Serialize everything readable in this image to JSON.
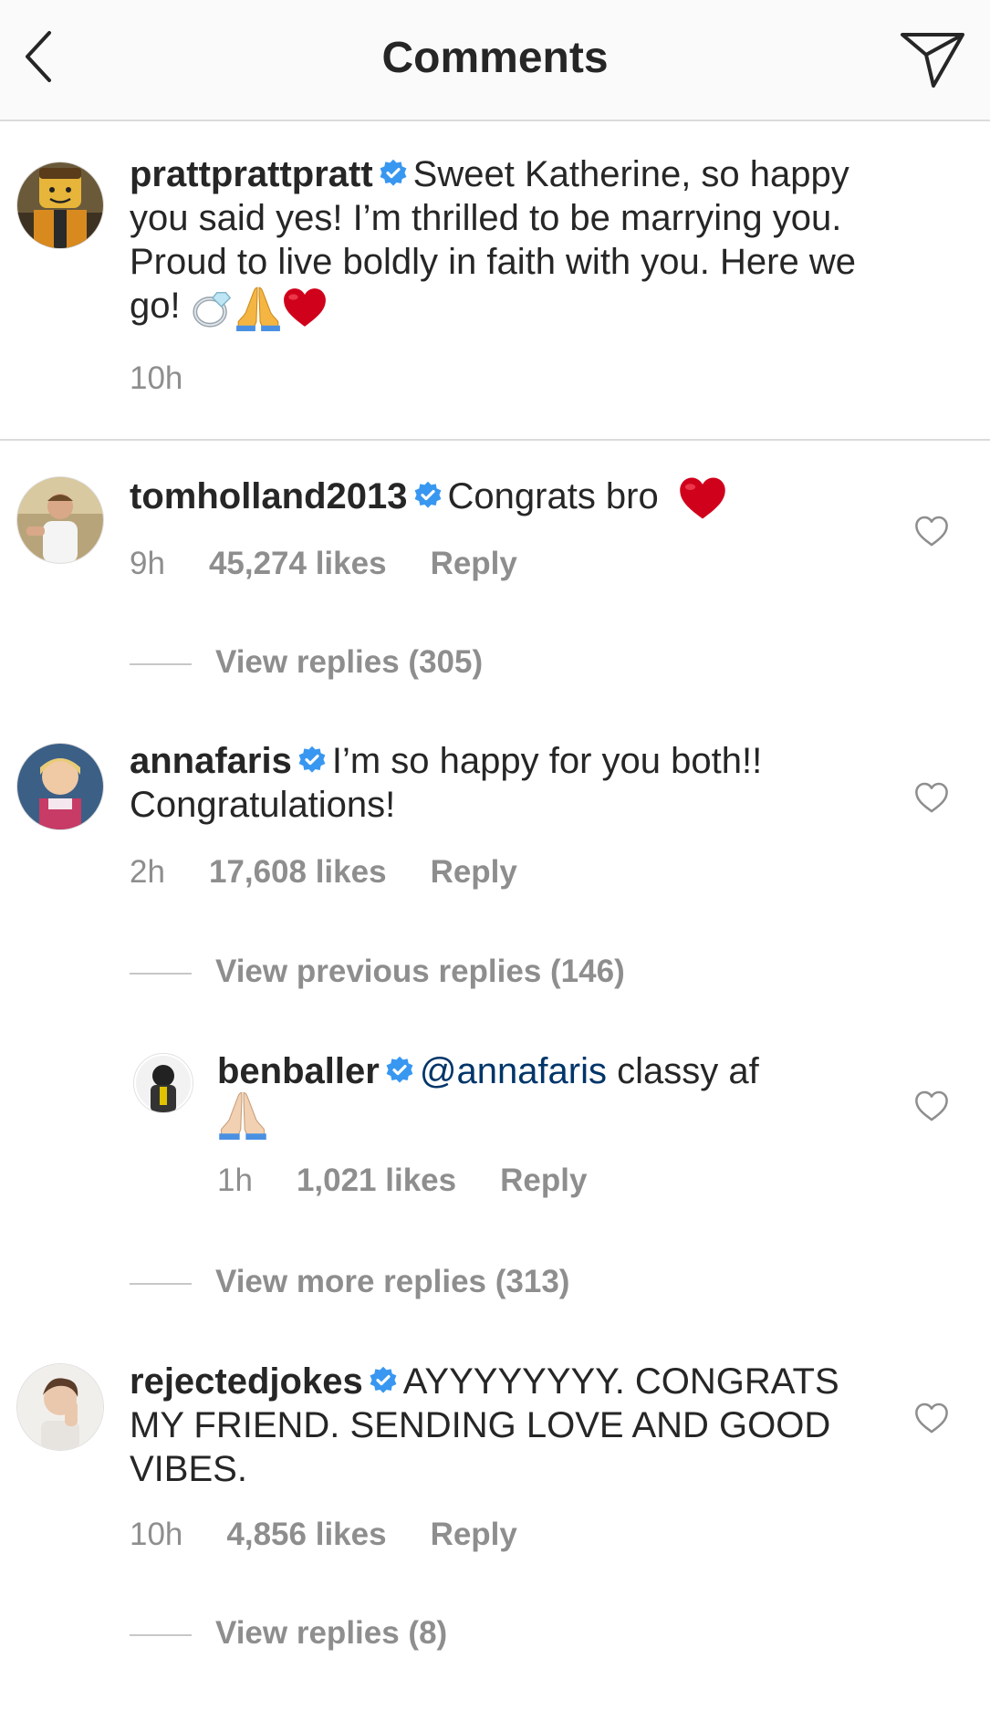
{
  "header": {
    "title": "Comments"
  },
  "post": {
    "username": "prattprattpratt",
    "text": "Sweet Katherine, so happy you said yes! I’m thrilled to be marrying you. Proud to live boldly in faith with you. Here we go!",
    "emoji": "ring, folded-hands, red-heart",
    "time": "10h"
  },
  "comments": [
    {
      "username": "tomholland2013",
      "text": "Congrats bro",
      "emoji": "red-heart",
      "time": "9h",
      "likes": "45,274 likes",
      "reply": "Reply",
      "view_replies": "View replies (305)"
    },
    {
      "username": "annafaris",
      "text": "I’m so happy for you both!! Congratulations!",
      "time": "2h",
      "likes": "17,608 likes",
      "reply": "Reply",
      "view_replies": "View previous replies (146)"
    },
    {
      "username": "benballer",
      "mention": "@annafaris",
      "text": "classy af",
      "emoji": "folded-hands",
      "time": "1h",
      "likes": "1,021 likes",
      "reply": "Reply",
      "view_replies": "View more replies (313)"
    },
    {
      "username": "rejectedjokes",
      "text": "AYYYYYYYY. CONGRATS MY FRIEND. SENDING LOVE AND GOOD VIBES.",
      "time": "10h",
      "likes": "4,856 likes",
      "reply": "Reply",
      "view_replies": "View replies (8)"
    }
  ],
  "colors": {
    "text": "#262626",
    "secondary": "#8e8e8e",
    "verified": "#3897f0",
    "mention": "#003569",
    "heart_emoji": "#d0021b"
  }
}
